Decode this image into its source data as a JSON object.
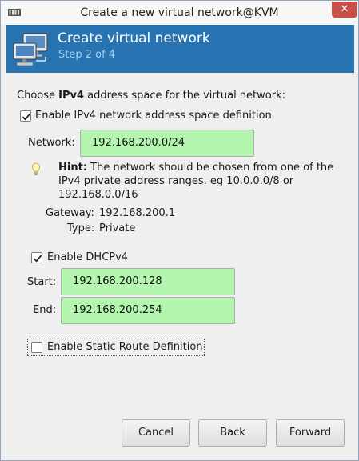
{
  "window": {
    "title": "Create a new virtual network@KVM",
    "close_glyph": "✕",
    "app_icon": "kvm-app-icon"
  },
  "header": {
    "title": "Create virtual network",
    "step": "Step 2 of 4",
    "icon": "network-computers-icon",
    "background": "#2873b1"
  },
  "form": {
    "intro_prefix": "Choose ",
    "intro_bold": "IPv4",
    "intro_suffix": " address space for the virtual network:",
    "enable_ipv4": {
      "label": "Enable IPv4 network address space definition",
      "checked": true
    },
    "network": {
      "label": "Network:",
      "value": "192.168.200.0/24"
    },
    "hint": {
      "bold": "Hint:",
      "text": " The network should be chosen from one of the IPv4 private address ranges. eg 10.0.0.0/8 or 192.168.0.0/16",
      "icon": "lightbulb-icon"
    },
    "gateway": {
      "label": "Gateway:",
      "value": "192.168.200.1"
    },
    "type": {
      "label": "Type:",
      "value": "Private"
    },
    "enable_dhcp": {
      "label": "Enable DHCPv4",
      "checked": true
    },
    "start": {
      "label": "Start:",
      "value": "192.168.200.128"
    },
    "end": {
      "label": "End:",
      "value": "192.168.200.254"
    },
    "static_route": {
      "label": "Enable Static Route Definition",
      "checked": false
    },
    "field_color": "#b4f5b0"
  },
  "buttons": {
    "cancel": "Cancel",
    "back": "Back",
    "forward": "Forward"
  }
}
